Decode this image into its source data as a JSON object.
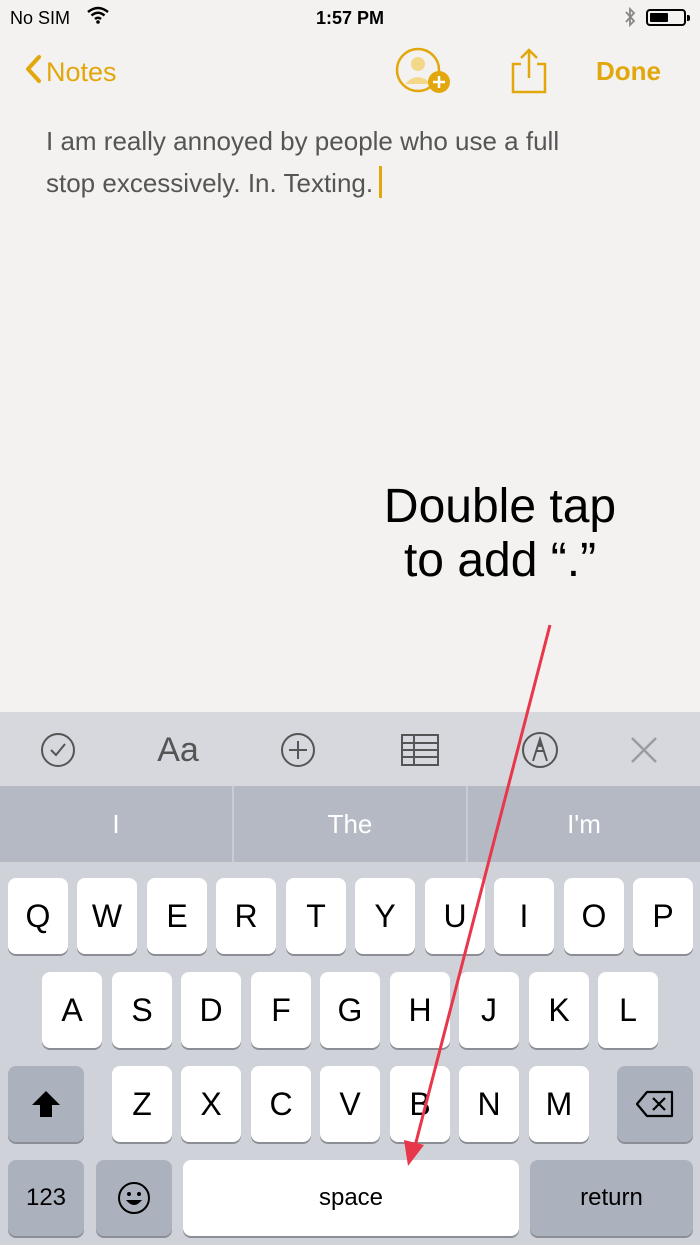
{
  "status_bar": {
    "carrier": "No SIM",
    "time": "1:57 PM",
    "battery_level": 0.55
  },
  "nav": {
    "back_label": "Notes",
    "done_label": "Done"
  },
  "note": {
    "line1": "I am really annoyed by people who use a full",
    "line2": "stop excessively. In. Texting."
  },
  "annotation": {
    "line1": "Double tap",
    "line2": "to add “.”"
  },
  "toolbar": {
    "format_label": "Aa"
  },
  "predictions": [
    "I",
    "The",
    "I'm"
  ],
  "keyboard": {
    "row1": [
      "Q",
      "W",
      "E",
      "R",
      "T",
      "Y",
      "U",
      "I",
      "O",
      "P"
    ],
    "row2": [
      "A",
      "S",
      "D",
      "F",
      "G",
      "H",
      "J",
      "K",
      "L"
    ],
    "row3": [
      "Z",
      "X",
      "C",
      "V",
      "B",
      "N",
      "M"
    ],
    "numbers_label": "123",
    "space_label": "space",
    "return_label": "return"
  },
  "colors": {
    "accent": "#e2a70c",
    "annotation_arrow": "#e8364a"
  }
}
